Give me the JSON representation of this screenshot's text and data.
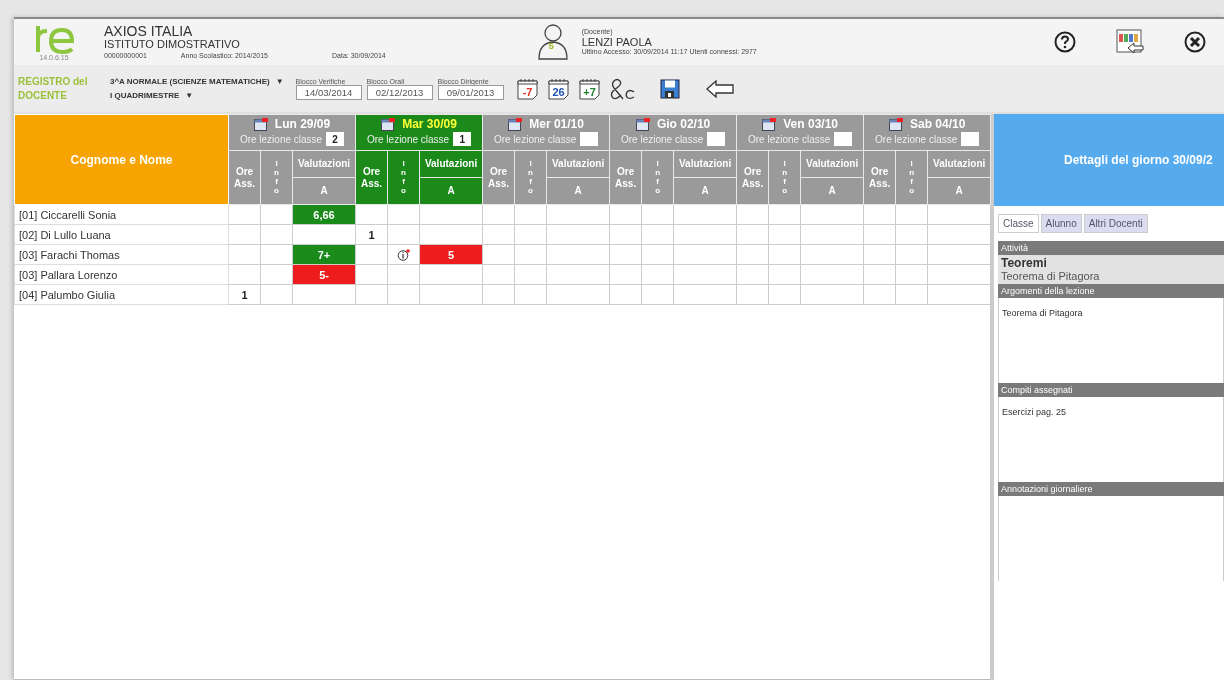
{
  "header": {
    "version": "14.0.6.15",
    "school_name": "AXIOS ITALIA",
    "school_type": "ISTITUTO DIMOSTRATIVO",
    "school_code": "00000000001",
    "school_year": "Anno Scolastico: 2014/2015",
    "date": "Data: 30/09/2014",
    "user_badge": "5",
    "user_role": "(Docente)",
    "user_name": "LENZI PAOLA",
    "last_access": "Ultimo Accesso: 30/09/2014 11:17 Utenti connessi: 2977"
  },
  "toolbar": {
    "title": "REGISTRO del DOCENTE",
    "class_select": "3^A NORMALE (SCIENZE MATEMATICHE)",
    "period_select": "I QUADRIMESTRE",
    "dropdown_glyph": "▼",
    "blocks": [
      {
        "label": "Blocco Verifiche",
        "value": "14/03/2014"
      },
      {
        "label": "Blocco Orali",
        "value": "02/12/2013"
      },
      {
        "label": "Blocco Dirigente",
        "value": "09/01/2013"
      }
    ],
    "calendar_buttons": [
      {
        "label": "-7",
        "color": "#e03020"
      },
      {
        "label": "26",
        "color": "#2050b0"
      },
      {
        "label": "+7",
        "color": "#208030"
      }
    ]
  },
  "table": {
    "name_header": "Cognome e Nome",
    "days": [
      {
        "label": "Lun 29/09",
        "hours": "2",
        "selected": false,
        "lesson_hours_label": "Ore lezione classe",
        "ore_header": "Ore Ass.",
        "info_header": "Info",
        "grades_header": "Valutazioni",
        "grades_sub": "A"
      },
      {
        "label": "Mar 30/09",
        "hours": "1",
        "selected": true,
        "lesson_hours_label": "Ore lezione classe",
        "ore_header": "Ore Ass.",
        "info_header": "Info",
        "grades_header": "Valutazioni",
        "grades_sub": "A"
      },
      {
        "label": "Mer 01/10",
        "selected": false,
        "lesson_hours_label": "Ore lezione classe",
        "ore_header": "Ore Ass.",
        "info_header": "Info",
        "grades_header": "Valutazioni",
        "grades_sub": "A"
      },
      {
        "label": "Gio 02/10",
        "selected": false,
        "lesson_hours_label": "Ore lezione classe",
        "ore_header": "Ore Ass.",
        "info_header": "Info",
        "grades_header": "Valutazioni",
        "grades_sub": "A"
      },
      {
        "label": "Ven 03/10",
        "selected": false,
        "lesson_hours_label": "Ore lezione classe",
        "ore_header": "Ore Ass.",
        "info_header": "Info",
        "grades_header": "Valutazioni",
        "grades_sub": "A"
      },
      {
        "label": "Sab 04/10",
        "selected": false,
        "lesson_hours_label": "Ore lezione classe",
        "ore_header": "Ore Ass.",
        "info_header": "Info",
        "grades_header": "Valutazioni",
        "grades_sub": "A"
      }
    ],
    "rows": [
      {
        "name": "[01] Ciccarelli Sonia",
        "cells": [
          {
            "grade": "6,66",
            "kind": "positive"
          },
          {},
          {},
          {},
          {},
          {}
        ]
      },
      {
        "name": "[02] Di Lullo Luana",
        "cells": [
          {},
          {
            "absence": "1"
          },
          {},
          {},
          {},
          {}
        ]
      },
      {
        "name": "[03] Farachi Thomas",
        "cells": [
          {
            "grade": "7+",
            "kind": "positive"
          },
          {
            "info": true,
            "grade": "5",
            "kind": "negative"
          },
          {},
          {},
          {},
          {}
        ]
      },
      {
        "name": "[03] Pallara Lorenzo",
        "cells": [
          {
            "grade": "5-",
            "kind": "negative"
          },
          {},
          {},
          {},
          {},
          {}
        ]
      },
      {
        "name": "[04] Palumbo Giulia",
        "cells": [
          {
            "absence": "1"
          },
          {},
          {},
          {},
          {},
          {}
        ]
      }
    ]
  },
  "details": {
    "title": "Dettagli del giorno 30/09/2",
    "tabs": [
      {
        "label": "Classe",
        "selected": true
      },
      {
        "label": "Alunno",
        "selected": false
      },
      {
        "label": "Altri Docenti",
        "selected": false
      }
    ],
    "sections": [
      {
        "header": "Attività",
        "kind": "activity",
        "title": "Teoremi",
        "subtitle": "Teorema di Pitagora"
      },
      {
        "header": "Argomenti della lezione",
        "kind": "text",
        "text": "Teorema di Pitagora"
      },
      {
        "header": "Compiti assegnati",
        "kind": "text",
        "text": "Esercizi pag. 25"
      },
      {
        "header": "Annotazioni giornaliere",
        "kind": "text"
      }
    ]
  }
}
